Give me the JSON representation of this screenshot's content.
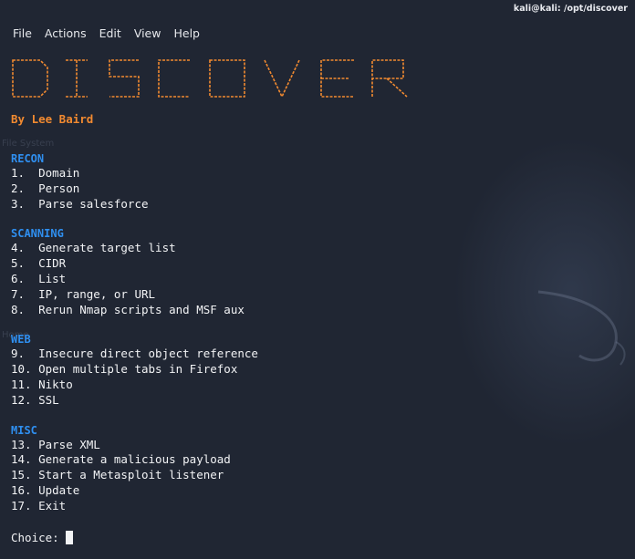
{
  "window": {
    "title": "kali@kali: /opt/discover"
  },
  "menu": [
    {
      "label": "File"
    },
    {
      "label": "Actions"
    },
    {
      "label": "Edit"
    },
    {
      "label": "View"
    },
    {
      "label": "Help"
    }
  ],
  "banner": {
    "text": "DISCOVER",
    "color": "#f28a30"
  },
  "author": "By Lee Baird",
  "sections": [
    {
      "title": "RECON",
      "options": [
        "1.  Domain",
        "2.  Person",
        "3.  Parse salesforce"
      ]
    },
    {
      "title": "SCANNING",
      "options": [
        "4.  Generate target list",
        "5.  CIDR",
        "6.  List",
        "7.  IP, range, or URL",
        "8.  Rerun Nmap scripts and MSF aux"
      ]
    },
    {
      "title": "WEB",
      "options": [
        "9.  Insecure direct object reference",
        "10. Open multiple tabs in Firefox",
        "11. Nikto",
        "12. SSL"
      ]
    },
    {
      "title": "MISC",
      "options": [
        "13. Parse XML",
        "14. Generate a malicious payload",
        "15. Start a Metasploit listener",
        "16. Update",
        "17. Exit"
      ]
    }
  ],
  "prompt": {
    "label": "Choice:",
    "value": ""
  },
  "colors": {
    "background": "#202633",
    "section_title": "#2f8ff0",
    "accent": "#f28a30",
    "text": "#f2f3f5"
  },
  "background_desktop_labels": [
    "File System",
    "Home"
  ]
}
